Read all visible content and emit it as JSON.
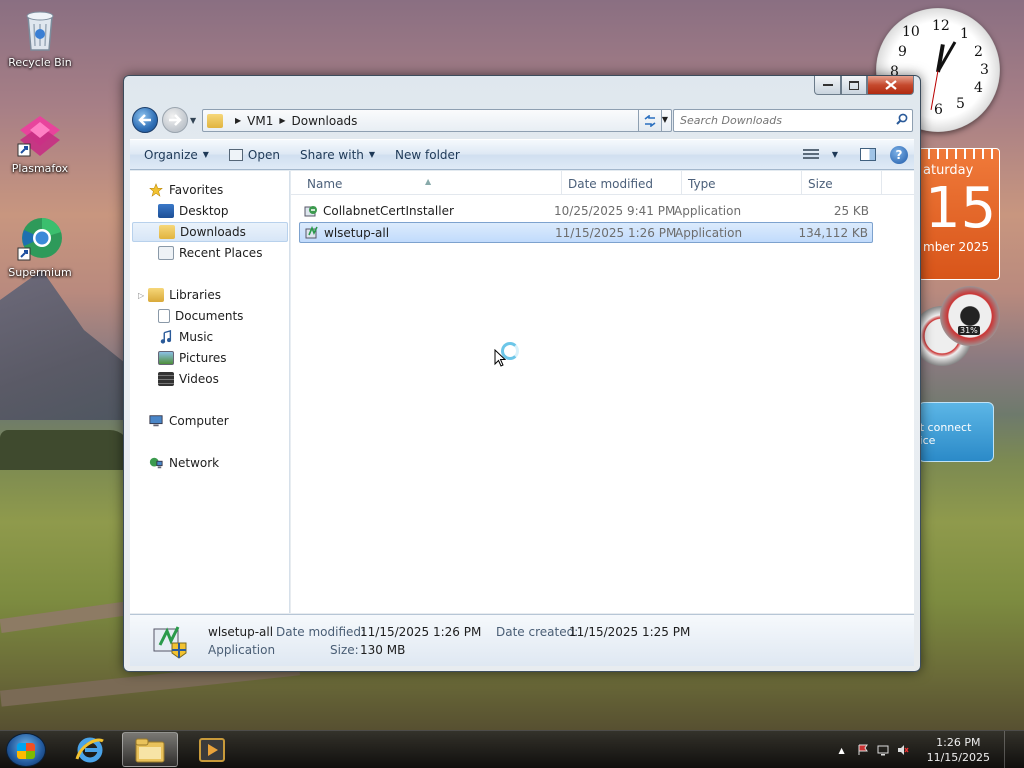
{
  "desktop": {
    "icons": [
      {
        "label": "Recycle Bin",
        "icon": "recycle-bin-icon"
      },
      {
        "label": "Plasmafox",
        "icon": "plasmafox-icon"
      },
      {
        "label": "Supermium",
        "icon": "supermium-icon"
      }
    ]
  },
  "gadgets": {
    "clock_numbers": [
      "12",
      "1",
      "2",
      "3",
      "4",
      "5",
      "6",
      "7",
      "8",
      "9",
      "10",
      "11"
    ],
    "calendar": {
      "day": "aturday",
      "date": "15",
      "month": "mber 2025"
    },
    "meter": {
      "percent": "31%"
    },
    "weather": {
      "line1": "ot connect",
      "line2": "vice"
    }
  },
  "window": {
    "breadcrumb": [
      "VM1",
      "Downloads"
    ],
    "search_placeholder": "Search Downloads",
    "toolbar": {
      "organize": "Organize",
      "open": "Open",
      "share_with": "Share with",
      "new_folder": "New folder"
    },
    "nav": {
      "favorites": "Favorites",
      "desktop": "Desktop",
      "downloads": "Downloads",
      "recent_places": "Recent Places",
      "libraries": "Libraries",
      "documents": "Documents",
      "music": "Music",
      "pictures": "Pictures",
      "videos": "Videos",
      "computer": "Computer",
      "network": "Network"
    },
    "columns": {
      "name": "Name",
      "date_modified": "Date modified",
      "type": "Type",
      "size": "Size"
    },
    "files": [
      {
        "name": "CollabnetCertInstaller",
        "date": "10/25/2025 9:41 PM",
        "type": "Application",
        "size": "25 KB"
      },
      {
        "name": "wlsetup-all",
        "date": "11/15/2025 1:26 PM",
        "type": "Application",
        "size": "134,112 KB"
      }
    ],
    "details": {
      "name": "wlsetup-all",
      "type": "Application",
      "date_modified_label": "Date modified:",
      "date_modified": "11/15/2025 1:26 PM",
      "date_created_label": "Date created:",
      "date_created": "11/15/2025 1:25 PM",
      "size_label": "Size:",
      "size": "130 MB"
    }
  },
  "taskbar": {
    "time": "1:26 PM",
    "date": "11/15/2025"
  },
  "colors": {
    "accent": "#3399ff",
    "selection": "#cce4fc",
    "close_button": "#c54a2e"
  }
}
